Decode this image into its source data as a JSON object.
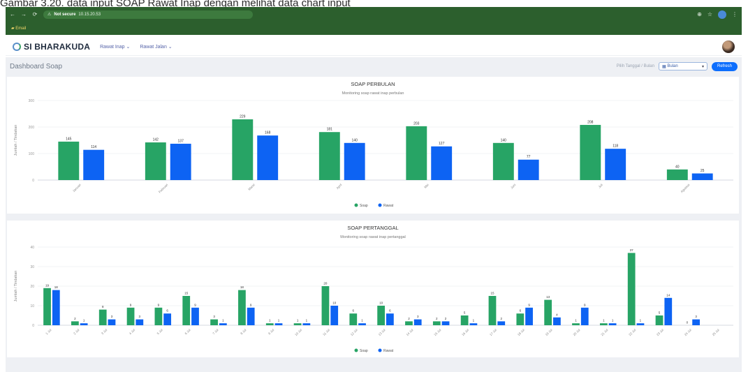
{
  "caption": "Gambar 3.20. data input SOAP Rawat Inap dengan melihat data chart input",
  "browser": {
    "address_label": "Not secure",
    "address_url": "10.15.20.53",
    "bookmark": "Email"
  },
  "app": {
    "logo": "SI BHARAKUDA",
    "menus": [
      "Rawat Inap",
      "Rawat Jalan"
    ]
  },
  "page": {
    "title": "Dashboard Soap",
    "filter_hint": "Pilih Tanggal / Bulan",
    "select_value": "Bulan",
    "button_label": "Refresh"
  },
  "colors": {
    "soap": "#27a465",
    "rawat": "#0d63f3"
  },
  "chart_data": [
    {
      "type": "bar",
      "title": "SOAP PERBULAN",
      "subtitle": "Monitoring soap rawat inap perbulan",
      "ylabel": "Jumlah / Tindakan",
      "ylim": [
        0,
        300
      ],
      "yticks": [
        0,
        100,
        200,
        300
      ],
      "categories": [
        "Januari",
        "Februari",
        "Maret",
        "April",
        "Mei",
        "Juni",
        "Juli",
        "Agustus"
      ],
      "series": [
        {
          "name": "Soap",
          "values": [
            145,
            142,
            229,
            181,
            203,
            140,
            208,
            40
          ]
        },
        {
          "name": "Rawat",
          "values": [
            114,
            137,
            168,
            140,
            127,
            77,
            118,
            25
          ]
        }
      ],
      "legend": "bottom"
    },
    {
      "type": "bar",
      "title": "SOAP PERTANGGAL",
      "subtitle": "Monitoring soap rawat inap pertanggal",
      "ylabel": "Jumlah / Tindakan",
      "ylim": [
        0,
        40
      ],
      "yticks": [
        0,
        10,
        20,
        30,
        40
      ],
      "categories": [
        "1 Jul",
        "2 Jul",
        "3 Jul",
        "4 Jul",
        "5 Jul",
        "6 Jul",
        "7 Jul",
        "8 Jul",
        "9 Jul",
        "10 Jul",
        "11 Jul",
        "12 Jul",
        "13 Jul",
        "14 Jul",
        "15 Jul",
        "16 Jul",
        "17 Jul",
        "18 Jul",
        "19 Jul",
        "20 Jul",
        "21 Jul",
        "22 Jul",
        "23 Jul",
        "24 Jul",
        "25 Jul"
      ],
      "series": [
        {
          "name": "Soap",
          "values": [
            19,
            2,
            8,
            9,
            9,
            15,
            3,
            18,
            1,
            1,
            20,
            6,
            10,
            2,
            2,
            5,
            15,
            6,
            13,
            1,
            1,
            37,
            5,
            0
          ]
        },
        {
          "name": "Rawat",
          "values": [
            18,
            1,
            3,
            3,
            6,
            9,
            1,
            9,
            1,
            1,
            10,
            1,
            6,
            3,
            2,
            1,
            2,
            9,
            4,
            9,
            1,
            1,
            14,
            3
          ]
        }
      ],
      "legend": "bottom"
    }
  ]
}
